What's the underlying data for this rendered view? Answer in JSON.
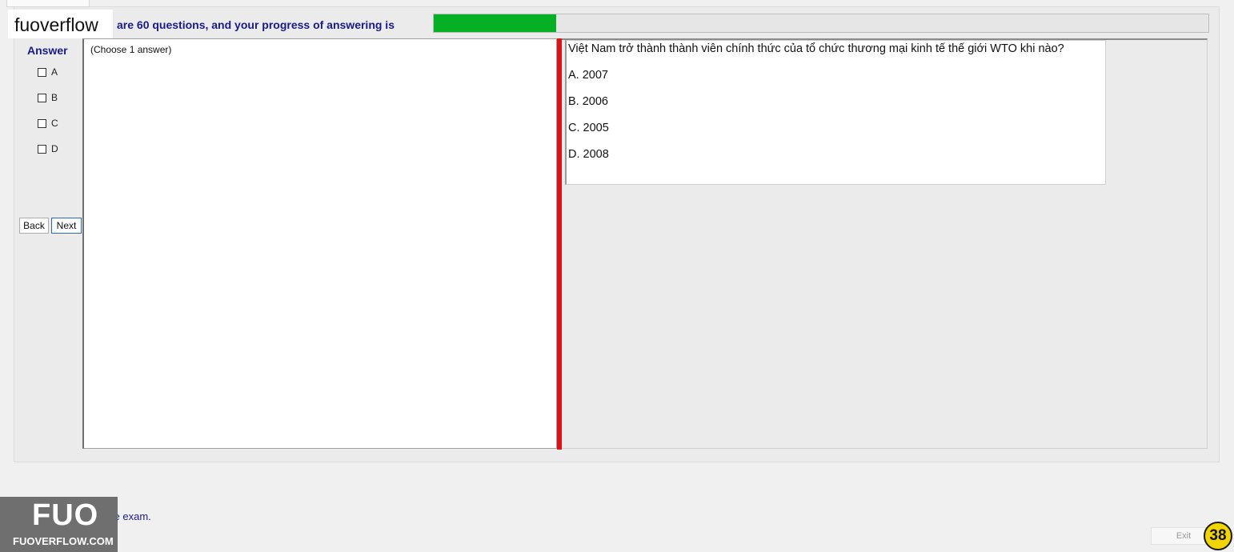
{
  "brand": {
    "name": "fuoverflow"
  },
  "progress": {
    "text": "are 60 questions, and your progress of answering is",
    "fraction": 0.158
  },
  "answer_panel": {
    "title": "Answer",
    "options": [
      "A",
      "B",
      "C",
      "D"
    ],
    "back_label": "Back",
    "next_label": "Next"
  },
  "left_pane": {
    "hint": "(Choose 1 answer)"
  },
  "question": {
    "text": "Việt Nam trở thành thành viên chính thức của tổ chức thương mại kinh tế thế giới WTO khi nào?",
    "choices": [
      "A.  2007",
      "B.  2006",
      "C.  2005",
      "D.  2008"
    ]
  },
  "footer": {
    "finish_text": "I want to finish the exam.",
    "logo_text": "FUO",
    "logo_site": "FUOVERFLOW.COM",
    "exit_label": "Exit",
    "counter": "38"
  },
  "colors": {
    "progress_fill": "#06b025",
    "splitter": "#d9151a",
    "label_blue": "#1a1a8c",
    "counter_badge": "#f2d400"
  }
}
